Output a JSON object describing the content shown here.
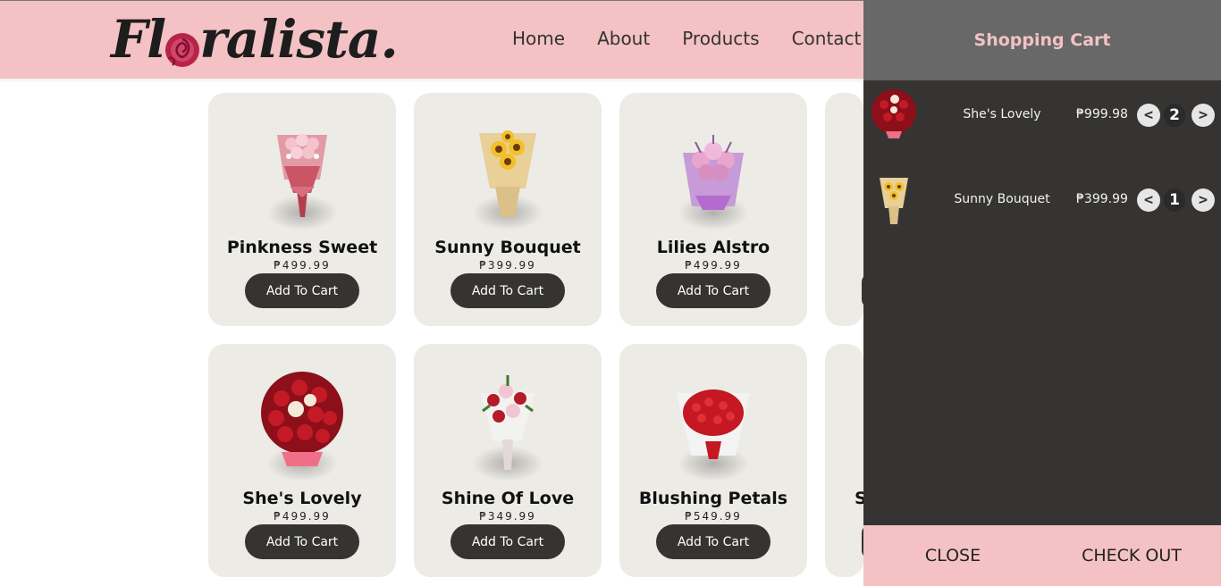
{
  "brand": {
    "name_start": "Fl",
    "name_end": "ralista."
  },
  "nav": [
    "Home",
    "About",
    "Products",
    "Contact"
  ],
  "products": [
    {
      "name": "Pinkness Sweet",
      "price": "₱499.99",
      "button": "Add To Cart",
      "icon": "pink-bouquet-icon"
    },
    {
      "name": "Sunny Bouquet",
      "price": "₱399.99",
      "button": "Add To Cart",
      "icon": "sunflower-bouquet-icon"
    },
    {
      "name": "Lilies Alstro",
      "price": "₱499.99",
      "button": "Add To Cart",
      "icon": "lily-bouquet-icon"
    },
    {
      "name": "She's Lovely",
      "price": "₱499.99",
      "button": "Add To Cart",
      "icon": "red-rose-bouquet-icon"
    },
    {
      "name": "Shine Of Love",
      "price": "₱349.99",
      "button": "Add To Cart",
      "icon": "lily-rose-bouquet-icon"
    },
    {
      "name": "Blushing Petals",
      "price": "₱549.99",
      "button": "Add To Cart",
      "icon": "tulip-bouquet-icon"
    },
    {
      "partial_letter": "S"
    }
  ],
  "cart": {
    "title": "Shopping Cart",
    "items": [
      {
        "name": "She's Lovely",
        "price": "₱999.98",
        "qty": "2",
        "dec": "<",
        "inc": ">"
      },
      {
        "name": "Sunny Bouquet",
        "price": "₱399.99",
        "qty": "1",
        "dec": "<",
        "inc": ">"
      }
    ],
    "close": "CLOSE",
    "checkout": "CHECK OUT"
  },
  "colors": {
    "header": "#f4c2c4",
    "cart_bg": "#353432",
    "cart_head": "#686868",
    "button": "#353432",
    "card": "#ecebe6"
  }
}
